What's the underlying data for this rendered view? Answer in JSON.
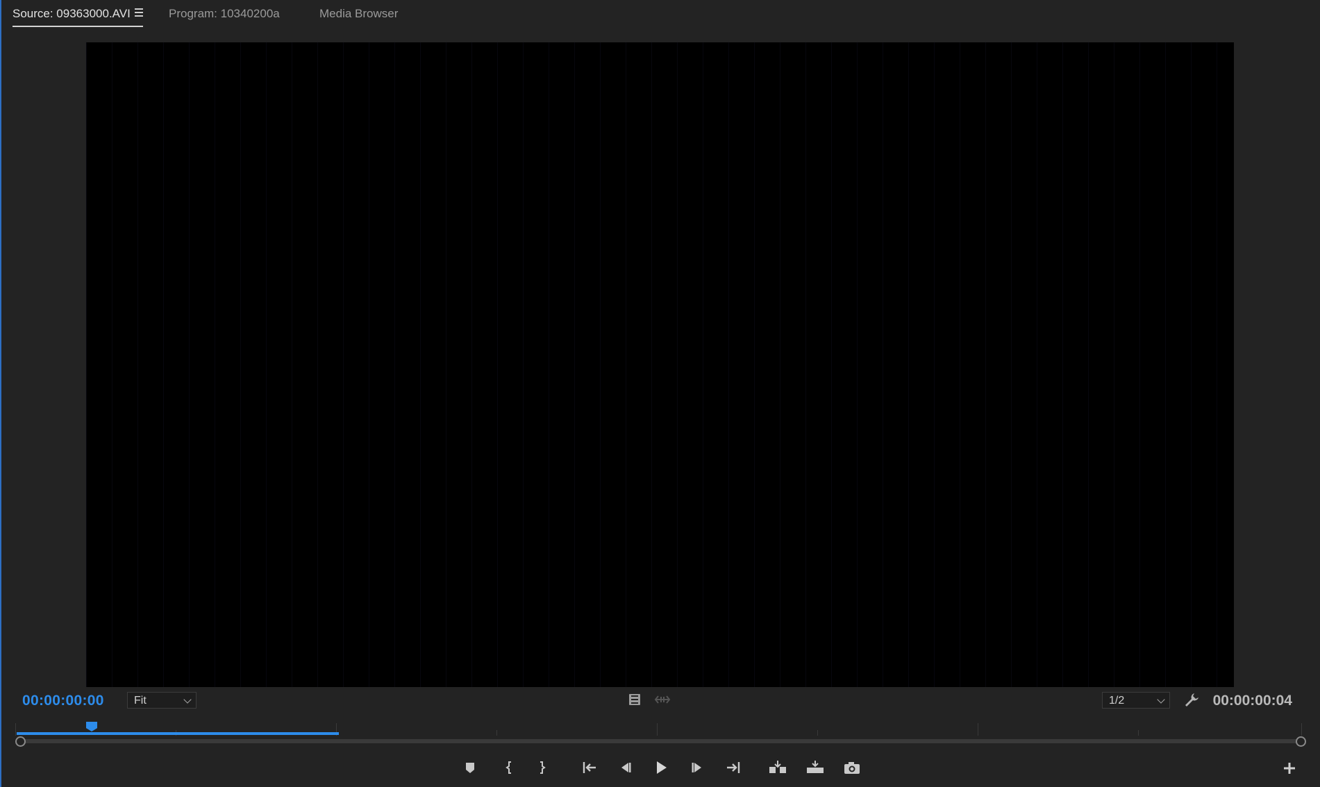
{
  "tabs": {
    "source_label": "Source: 09363000.AVI",
    "program_label": "Program: 10340200a",
    "media_browser_label": "Media Browser"
  },
  "monitor": {
    "current_timecode": "00:00:00:00",
    "duration_timecode": "00:00:00:04",
    "zoom_value": "Fit",
    "resolution_value": "1/2",
    "playhead_position": 0.048
  },
  "controls": [
    {
      "name": "add-marker-icon"
    },
    {
      "name": "mark-in-icon"
    },
    {
      "name": "mark-out-icon"
    },
    {
      "name": "go-to-in-icon"
    },
    {
      "name": "step-back-icon"
    },
    {
      "name": "play-icon"
    },
    {
      "name": "step-forward-icon"
    },
    {
      "name": "go-to-out-icon"
    },
    {
      "name": "insert-icon"
    },
    {
      "name": "overwrite-icon"
    },
    {
      "name": "export-frame-icon"
    },
    {
      "name": "button-editor-plus-icon"
    }
  ],
  "colors": {
    "accent": "#2d8ceb",
    "background": "#232323",
    "viewer": "#000000"
  }
}
